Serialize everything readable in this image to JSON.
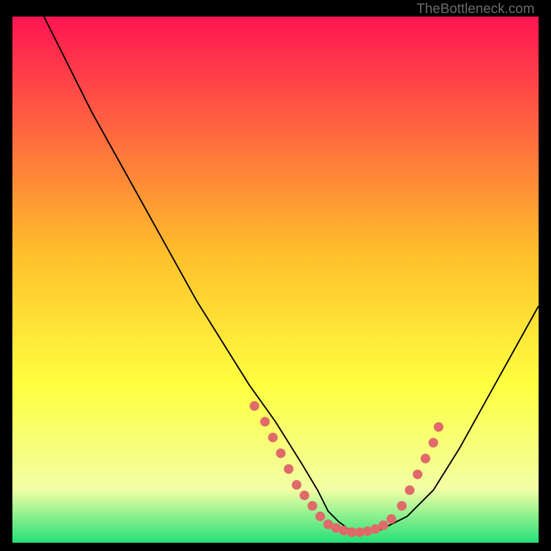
{
  "watermark": "TheBottleneck.com",
  "chart_data": {
    "type": "line",
    "title": "",
    "xlabel": "",
    "ylabel": "",
    "xlim": [
      0,
      100
    ],
    "ylim": [
      0,
      100
    ],
    "grid": false,
    "background_gradient": {
      "top": "#ff1452",
      "mid1": "#ffbf2b",
      "mid2": "#ffff40",
      "mid3": "#f1ffa5",
      "bottom": "#23e077"
    },
    "series": [
      {
        "name": "bottleneck-curve",
        "x": [
          6,
          10,
          15,
          20,
          25,
          30,
          35,
          40,
          45,
          50,
          55,
          58,
          60,
          62,
          64,
          66,
          70,
          75,
          80,
          85,
          90,
          95,
          100
        ],
        "y": [
          100,
          92,
          82,
          73,
          64,
          55,
          46,
          38,
          30,
          23,
          15,
          10,
          6,
          4,
          2.5,
          2,
          2.5,
          5,
          10,
          18,
          27,
          36,
          45
        ]
      }
    ],
    "highlight_band": {
      "name": "optimal-range-dots",
      "color": "#e06a6a",
      "points": [
        {
          "x": 46,
          "y": 26
        },
        {
          "x": 48,
          "y": 23
        },
        {
          "x": 49.5,
          "y": 20
        },
        {
          "x": 51,
          "y": 17
        },
        {
          "x": 52.5,
          "y": 14
        },
        {
          "x": 54,
          "y": 11
        },
        {
          "x": 55.5,
          "y": 9
        },
        {
          "x": 57,
          "y": 7
        },
        {
          "x": 58.5,
          "y": 5
        },
        {
          "x": 60,
          "y": 3.5
        },
        {
          "x": 61.5,
          "y": 2.8
        },
        {
          "x": 63,
          "y": 2.3
        },
        {
          "x": 64.5,
          "y": 2
        },
        {
          "x": 66,
          "y": 2
        },
        {
          "x": 67.5,
          "y": 2.2
        },
        {
          "x": 69,
          "y": 2.6
        },
        {
          "x": 70.5,
          "y": 3.3
        },
        {
          "x": 72,
          "y": 4.5
        },
        {
          "x": 74,
          "y": 7
        },
        {
          "x": 75.5,
          "y": 10
        },
        {
          "x": 77,
          "y": 13
        },
        {
          "x": 78.5,
          "y": 16
        },
        {
          "x": 80,
          "y": 19
        },
        {
          "x": 81,
          "y": 22
        }
      ]
    }
  }
}
